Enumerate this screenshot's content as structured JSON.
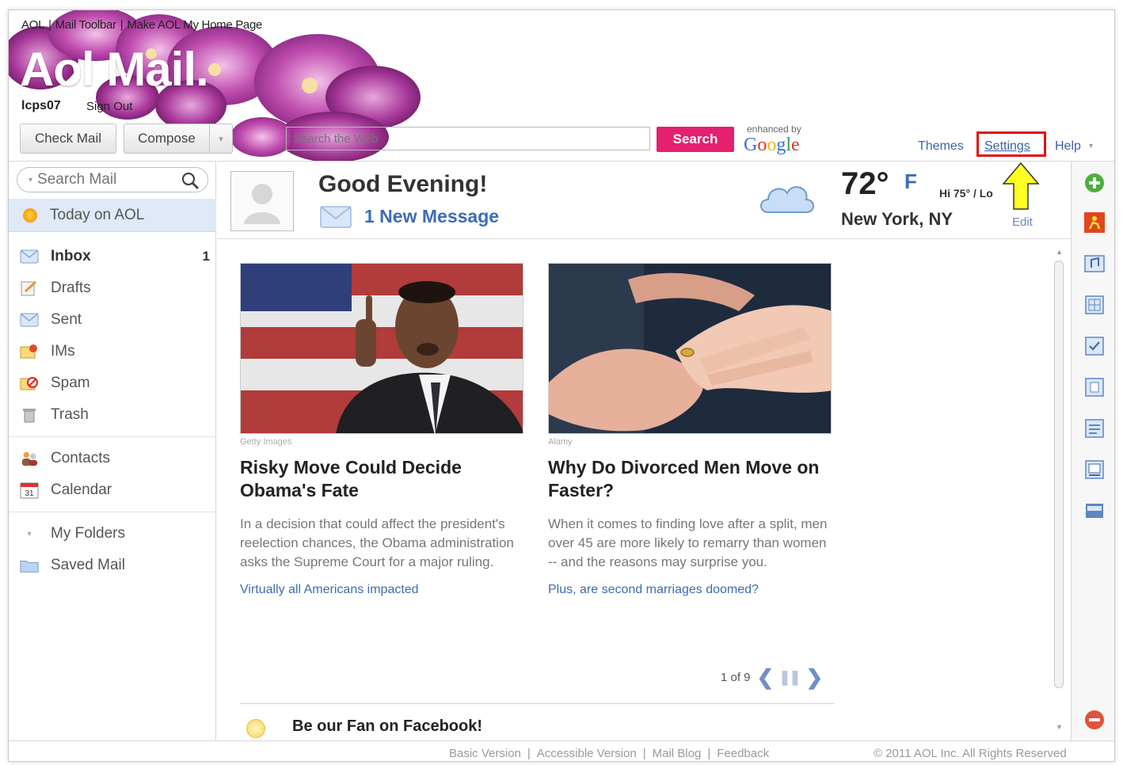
{
  "header": {
    "top_links": [
      "AOL",
      "Mail Toolbar",
      "Make AOL My Home Page"
    ],
    "logo": "Aol Mail.",
    "username": "lcps07",
    "sign_out": "Sign Out",
    "check_mail": "Check Mail",
    "compose": "Compose",
    "web_search_placeholder": "Search the Web",
    "search_button": "Search",
    "enhanced_by": "enhanced by",
    "google": [
      "G",
      "o",
      "o",
      "g",
      "l",
      "e"
    ],
    "themes": "Themes",
    "settings": "Settings",
    "help": "Help",
    "highlight_color": "#e21111",
    "accent_color": "#e5206f"
  },
  "sidebar": {
    "search_placeholder": "Search Mail",
    "today": "Today on AOL",
    "folders": [
      {
        "label": "Inbox",
        "count": "1",
        "icon": "envelope-icon"
      },
      {
        "label": "Drafts",
        "icon": "pencil-icon"
      },
      {
        "label": "Sent",
        "icon": "sent-icon"
      },
      {
        "label": "IMs",
        "icon": "im-icon"
      },
      {
        "label": "Spam",
        "icon": "spam-icon"
      },
      {
        "label": "Trash",
        "icon": "trash-icon"
      }
    ],
    "tools": [
      {
        "label": "Contacts",
        "icon": "contacts-icon"
      },
      {
        "label": "Calendar",
        "icon": "calendar-icon",
        "icon_text": "31"
      }
    ],
    "my_folders": "My Folders",
    "saved_mail": "Saved Mail"
  },
  "greeting": {
    "title": "Good Evening!",
    "new_messages": "1 New Message"
  },
  "weather": {
    "temp": "72°",
    "unit": "F",
    "hilo": "Hi 75° / Lo",
    "city": "New York, NY",
    "edit": "Edit"
  },
  "stories": [
    {
      "credit": "Getty Images",
      "title": "Risky Move Could Decide Obama's Fate",
      "body": "In a decision that could affect the president's reelection chances, the Obama administration asks the Supreme Court for a major ruling.",
      "link": "Virtually all Americans impacted"
    },
    {
      "credit": "Alamy",
      "title": "Why Do Divorced Men Move on Faster?",
      "body": "When it comes to finding love after a split, men over 45 are more likely to remarry than women -- and the reasons may surprise you.",
      "link": "Plus, are second marriages doomed?"
    }
  ],
  "pager": {
    "text": "1 of 9"
  },
  "facebook": "Be our Fan on Facebook!",
  "footer": {
    "links": [
      "Basic Version",
      "Accessible Version",
      "Mail Blog",
      "Feedback"
    ],
    "copyright": "© 2011 AOL Inc. All Rights Reserved"
  }
}
